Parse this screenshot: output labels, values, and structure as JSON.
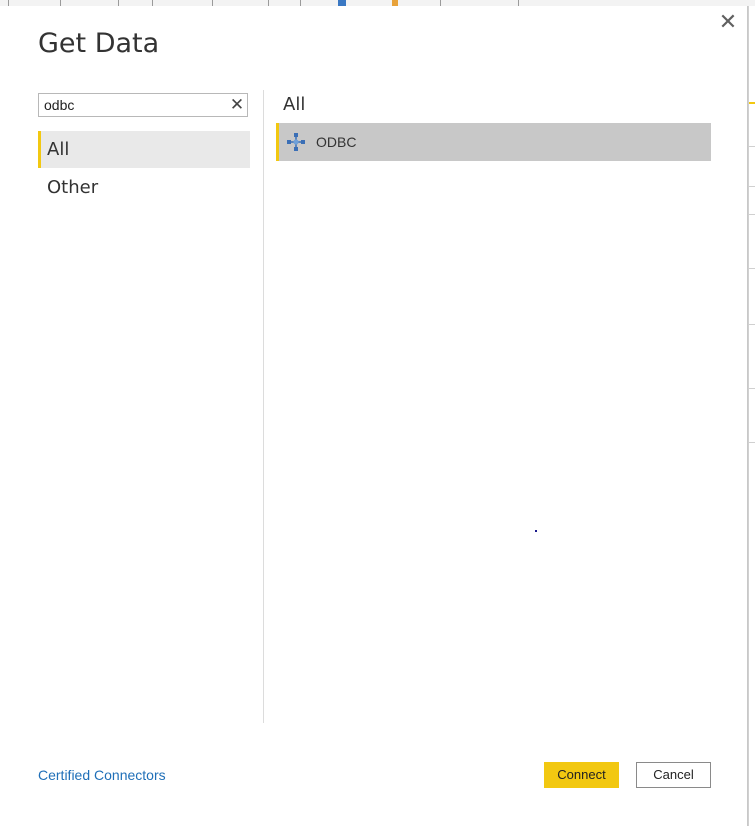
{
  "dialog": {
    "title": "Get Data",
    "close_glyph": "✕"
  },
  "search": {
    "value": "odbc",
    "clear_glyph": "✕"
  },
  "categories": [
    {
      "label": "All",
      "selected": true
    },
    {
      "label": "Other",
      "selected": false
    }
  ],
  "results": {
    "heading": "All",
    "items": [
      {
        "label": "ODBC",
        "icon": "odbc-connector-icon",
        "selected": true
      }
    ]
  },
  "footer": {
    "certified_link": "Certified Connectors",
    "connect_label": "Connect",
    "cancel_label": "Cancel"
  },
  "colors": {
    "accent": "#f2c811",
    "link": "#1f6fb8",
    "selected_row": "#c8c8c8",
    "selected_category": "#e9e9e9",
    "icon_blue": "#3b6fb6"
  }
}
